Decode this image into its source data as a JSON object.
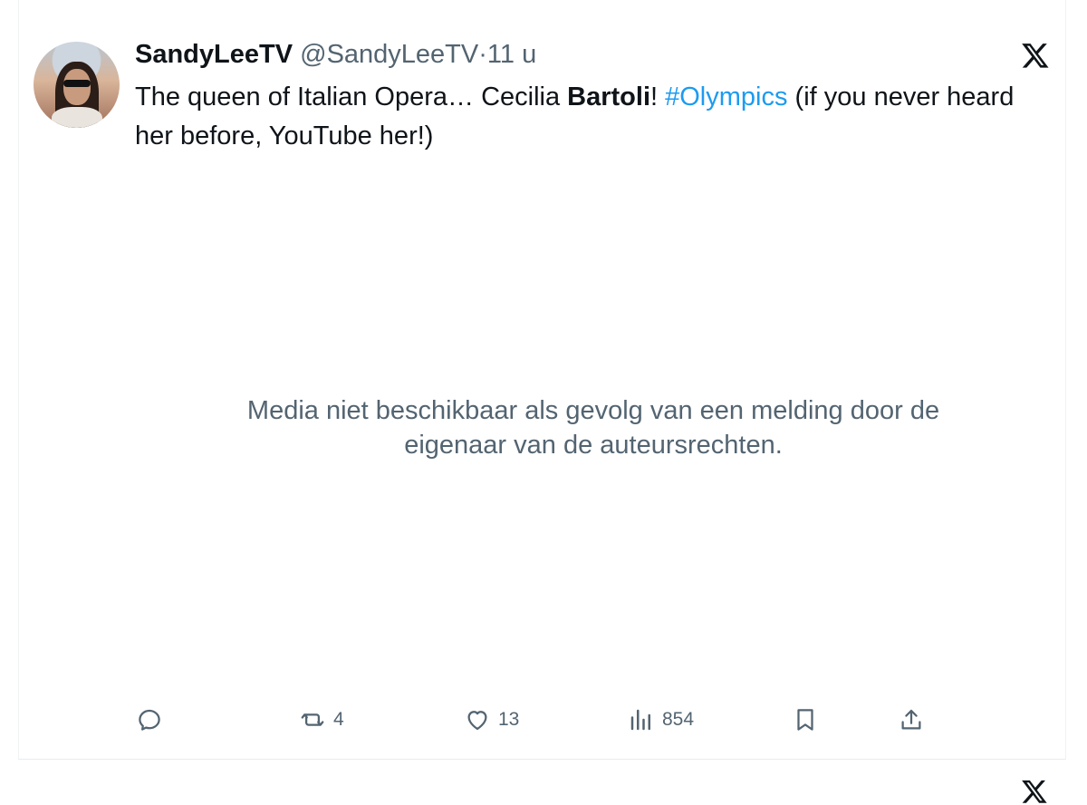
{
  "tweet": {
    "display_name": "SandyLeeTV",
    "handle": "@SandyLeeTV",
    "separator": "·",
    "time": "11 u",
    "text_part1": "The queen of Italian Opera… Cecilia ",
    "text_bold": "Bartoli",
    "text_part2": "! ",
    "hashtag": "#Olympics",
    "text_part3": " (if you never heard her before, YouTube her!)",
    "media_notice": "Media niet beschikbaar als gevolg van een melding door de eigenaar van de auteursrechten."
  },
  "actions": {
    "reply_icon": "reply-icon",
    "retweet_icon": "retweet-icon",
    "retweet_count": "4",
    "like_icon": "heart-icon",
    "like_count": "13",
    "views_icon": "views-icon",
    "views_count": "854",
    "bookmark_icon": "bookmark-icon",
    "share_icon": "share-icon"
  },
  "colors": {
    "hashtag": "#1d9bf0",
    "muted": "#536471",
    "text": "#0f1419"
  }
}
